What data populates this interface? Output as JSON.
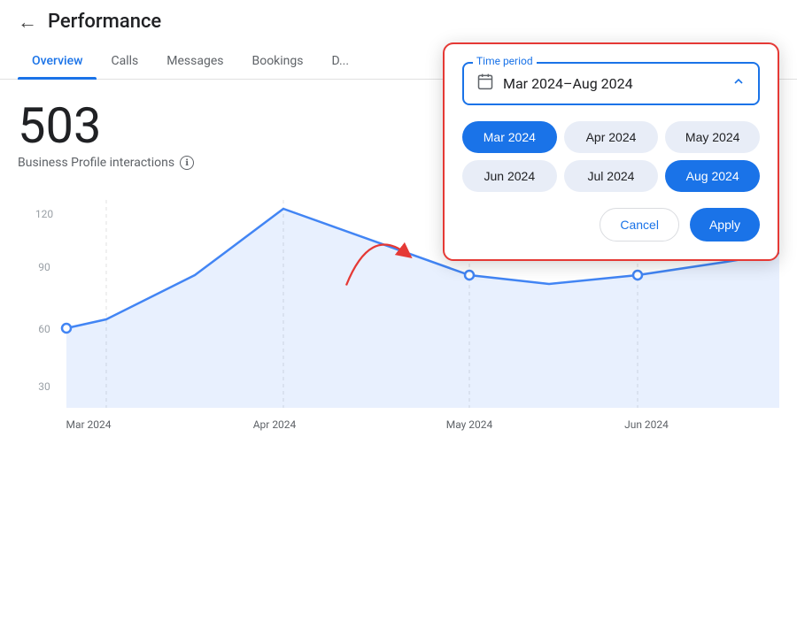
{
  "header": {
    "back_label": "←",
    "title": "Performance"
  },
  "tabs": [
    {
      "id": "overview",
      "label": "Overview",
      "active": true
    },
    {
      "id": "calls",
      "label": "Calls",
      "active": false
    },
    {
      "id": "messages",
      "label": "Messages",
      "active": false
    },
    {
      "id": "bookings",
      "label": "Bookings",
      "active": false
    },
    {
      "id": "directions",
      "label": "D...",
      "active": false
    }
  ],
  "metric": {
    "value": "503",
    "label": "Business Profile interactions",
    "info_icon": "ℹ"
  },
  "dropdown": {
    "time_period_label": "Time period",
    "date_range": "Mar 2024–Aug 2024",
    "calendar_icon": "📅",
    "chevron_up": "▲",
    "months": [
      {
        "label": "Mar 2024",
        "selected": "start"
      },
      {
        "label": "Apr 2024",
        "selected": false
      },
      {
        "label": "May 2024",
        "selected": false
      },
      {
        "label": "Jun 2024",
        "selected": false
      },
      {
        "label": "Jul 2024",
        "selected": false
      },
      {
        "label": "Aug 2024",
        "selected": "end"
      }
    ],
    "cancel_label": "Cancel",
    "apply_label": "Apply"
  },
  "chart": {
    "y_labels": [
      "120",
      "90",
      "60",
      "30"
    ],
    "x_labels": [
      "Mar 2024",
      "Apr 2024",
      "May 2024",
      "Jun 2024"
    ]
  },
  "colors": {
    "accent": "#1a73e8",
    "tab_active": "#1a73e8",
    "tab_inactive": "#5f6368",
    "dropdown_border": "#e53935",
    "chart_line": "#4285f4",
    "chart_fill": "rgba(66,133,244,0.12)"
  }
}
